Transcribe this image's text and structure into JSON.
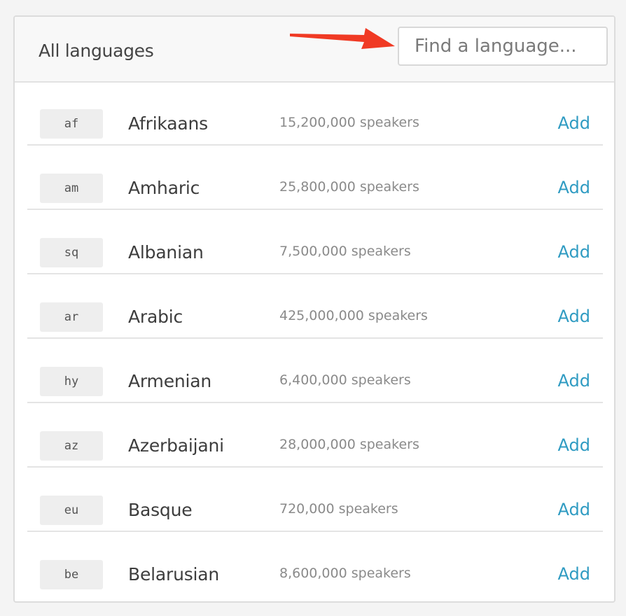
{
  "header": {
    "title": "All languages",
    "search_placeholder": "Find a language..."
  },
  "colors": {
    "accent_link": "#2f9bc2",
    "annotation_arrow": "#f03a24"
  },
  "languages": [
    {
      "code": "af",
      "name": "Afrikaans",
      "speakers": "15,200,000 speakers",
      "action": "Add"
    },
    {
      "code": "am",
      "name": "Amharic",
      "speakers": "25,800,000 speakers",
      "action": "Add"
    },
    {
      "code": "sq",
      "name": "Albanian",
      "speakers": "7,500,000 speakers",
      "action": "Add"
    },
    {
      "code": "ar",
      "name": "Arabic",
      "speakers": "425,000,000 speakers",
      "action": "Add"
    },
    {
      "code": "hy",
      "name": "Armenian",
      "speakers": "6,400,000 speakers",
      "action": "Add"
    },
    {
      "code": "az",
      "name": "Azerbaijani",
      "speakers": "28,000,000 speakers",
      "action": "Add"
    },
    {
      "code": "eu",
      "name": "Basque",
      "speakers": "720,000 speakers",
      "action": "Add"
    },
    {
      "code": "be",
      "name": "Belarusian",
      "speakers": "8,600,000 speakers",
      "action": "Add"
    }
  ]
}
